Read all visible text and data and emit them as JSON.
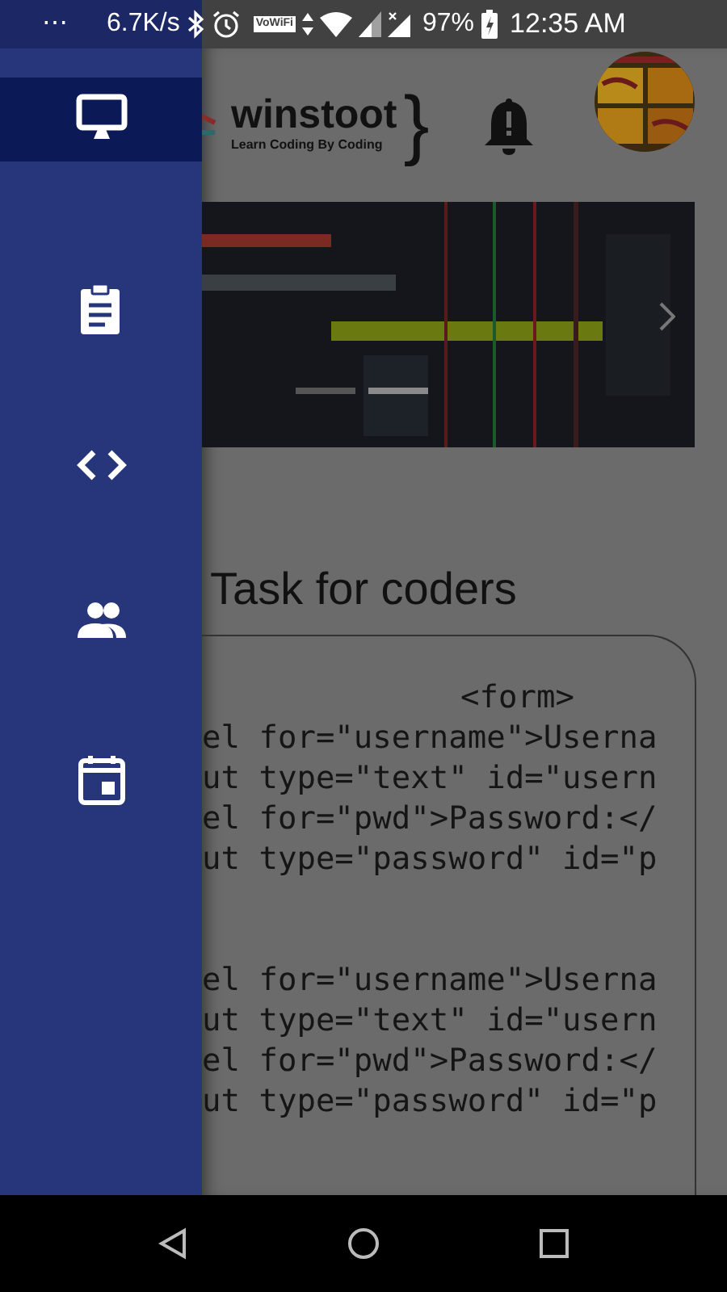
{
  "status_bar": {
    "overflow": "⋯",
    "speed": "6.7K/s",
    "vowifi": "VoWiFi",
    "battery": "97%",
    "time": "12:35 AM"
  },
  "drawer": {
    "items": [
      {
        "kind": "monitor",
        "selected": true
      },
      {
        "kind": "clipboard",
        "selected": false
      },
      {
        "kind": "code",
        "selected": false
      },
      {
        "kind": "people",
        "selected": false
      },
      {
        "kind": "calendar",
        "selected": false
      }
    ]
  },
  "header": {
    "brand": "winstoot",
    "tagline": "Learn Coding By Coding",
    "brace": "}"
  },
  "carousel": {
    "indicators": [
      {
        "selected": false
      },
      {
        "selected": true
      }
    ]
  },
  "section_title": "Task for coders",
  "code_lines": [
    {
      "kind": "text",
      "text": "<form>",
      "indent": true
    },
    {
      "kind": "text",
      "text": "el for=\"username\">Userna"
    },
    {
      "kind": "text",
      "text": "ut type=\"text\" id=\"usern"
    },
    {
      "kind": "text",
      "text": "el for=\"pwd\">Password:</"
    },
    {
      "kind": "text",
      "text": "ut type=\"password\" id=\"p"
    },
    {
      "kind": "blank"
    },
    {
      "kind": "blank"
    },
    {
      "kind": "text",
      "text": "el for=\"username\">Userna"
    },
    {
      "kind": "text",
      "text": "ut type=\"text\" id=\"usern"
    },
    {
      "kind": "text",
      "text": "el for=\"pwd\">Password:</"
    },
    {
      "kind": "text",
      "text": "ut type=\"password\" id=\"p"
    }
  ]
}
